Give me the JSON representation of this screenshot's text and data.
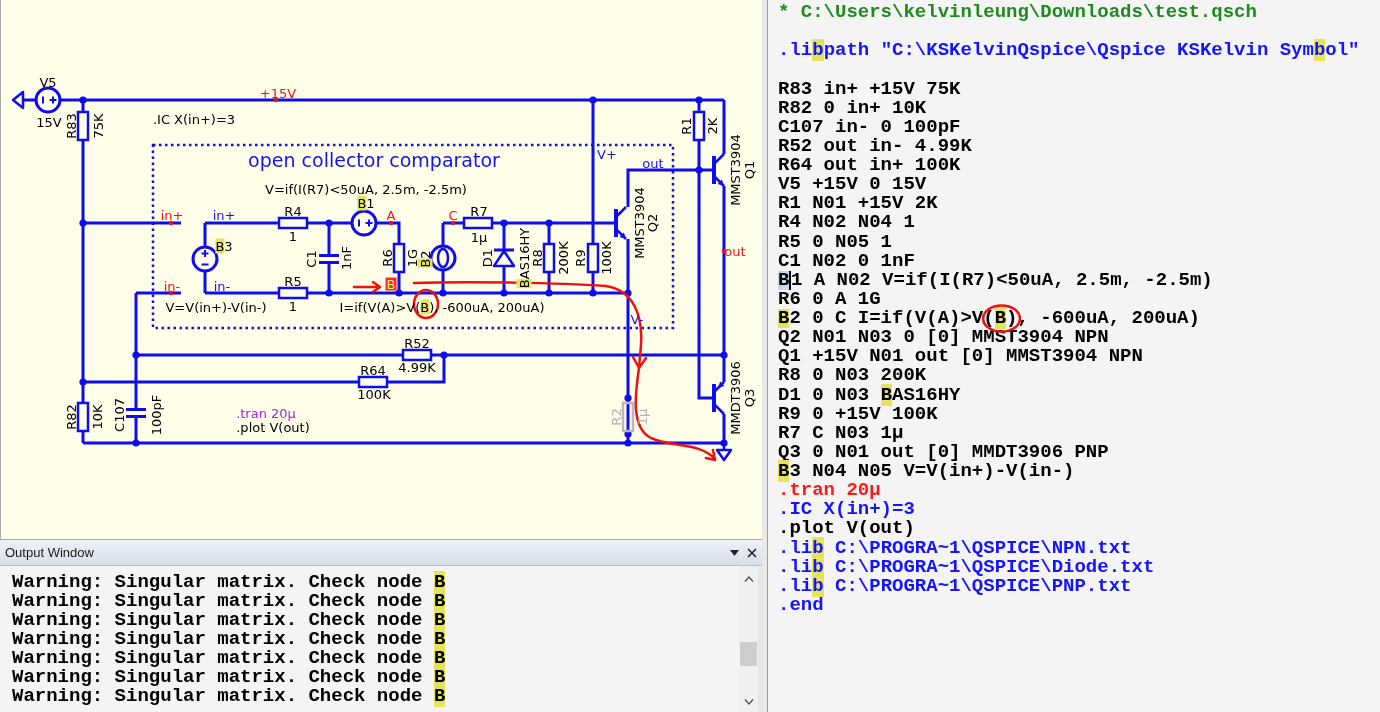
{
  "schematic": {
    "title": "open collector comparator",
    "directives": [
      {
        "text": ".IC X(in+)=3",
        "kind": "ic"
      },
      {
        "text": ".tran 20µ",
        "kind": "simulation"
      },
      {
        "text": ".plot V(out)",
        "kind": "plot"
      }
    ],
    "net_labels": [
      {
        "text": "+15V",
        "kind": "net"
      },
      {
        "text": "V+",
        "kind": "port"
      },
      {
        "text": "out",
        "kind": "port"
      },
      {
        "text": "in+",
        "kind": "net"
      },
      {
        "text": "in+",
        "kind": "port"
      },
      {
        "text": "A",
        "kind": "net"
      },
      {
        "text": "C",
        "kind": "net"
      },
      {
        "text": "out",
        "kind": "net"
      },
      {
        "text": "in-",
        "kind": "net"
      },
      {
        "text": "in-",
        "kind": "port"
      },
      {
        "text": "B",
        "kind": "flagged"
      },
      {
        "text": "V-",
        "kind": "port"
      }
    ],
    "expressions": [
      "V=if(I(R7)<50uA, 2.5m, -2.5m)",
      "V=V(in+)-V(in-)",
      [
        {
          "text": "I=if(V(A)>V(",
          "highlighted": false
        },
        {
          "text": "B",
          "highlighted": true
        },
        {
          "text": "), -600uA, 200uA)",
          "highlighted": false
        }
      ]
    ],
    "components": [
      {
        "kind": "voltage_source",
        "ref": "V5",
        "value": "15V",
        "disabled": false
      },
      {
        "kind": "resistor",
        "ref": "R83",
        "value": "75K",
        "disabled": false
      },
      {
        "kind": "resistor",
        "ref": "R1",
        "value": "2K",
        "disabled": false
      },
      {
        "kind": "npn",
        "ref": "Q1",
        "value": "MMST3904",
        "disabled": false
      },
      {
        "kind": "behavioral_voltage",
        "ref": [
          {
            "text": "B",
            "highlighted": true
          },
          {
            "text": "1",
            "highlighted": false
          }
        ],
        "disabled": false
      },
      {
        "kind": "resistor",
        "ref": "R4",
        "value": "1",
        "disabled": false
      },
      {
        "kind": "resistor",
        "ref": "R7",
        "value": "1µ",
        "disabled": false
      },
      {
        "kind": "npn",
        "ref": "Q2",
        "value": "MMST3904",
        "disabled": false
      },
      {
        "kind": "behavioral_voltage",
        "ref": [
          {
            "text": "B",
            "highlighted": true
          },
          {
            "text": "3",
            "highlighted": false
          }
        ],
        "disabled": false
      },
      {
        "kind": "capacitor",
        "ref": "C1",
        "value": "1nF",
        "disabled": false
      },
      {
        "kind": "resistor",
        "ref": "R6",
        "value": "1G",
        "disabled": false
      },
      {
        "kind": "behavioral_current",
        "ref": [
          {
            "text": "B",
            "highlighted": true
          },
          {
            "text": "2",
            "highlighted": false
          }
        ],
        "disabled": false
      },
      {
        "kind": "diode",
        "ref": "D1",
        "value": [
          {
            "text": "B",
            "highlighted": true
          },
          {
            "text": "AS16HY",
            "highlighted": false
          }
        ],
        "disabled": false
      },
      {
        "kind": "resistor",
        "ref": "R8",
        "value": "200K",
        "disabled": false
      },
      {
        "kind": "resistor",
        "ref": "R9",
        "value": "100K",
        "disabled": false
      },
      {
        "kind": "resistor",
        "ref": "R5",
        "value": "1",
        "disabled": false
      },
      {
        "kind": "resistor",
        "ref": "R52",
        "value": "4.99K",
        "disabled": false
      },
      {
        "kind": "resistor",
        "ref": "R64",
        "value": "100K",
        "disabled": false
      },
      {
        "kind": "resistor",
        "ref": "R82",
        "value": "10K",
        "disabled": false
      },
      {
        "kind": "capacitor",
        "ref": "C107",
        "value": "100pF",
        "disabled": false
      },
      {
        "kind": "resistor",
        "ref": "R2",
        "value": "1µ",
        "disabled": true
      },
      {
        "kind": "pnp",
        "ref": "Q3",
        "value": "MMDT3906",
        "disabled": false
      }
    ]
  },
  "output_window": {
    "title": "Output Window",
    "lines": [
      {
        "parts": [
          {
            "text": "Warning: Singular matrix. Check node ",
            "highlighted": false
          },
          {
            "text": "B",
            "highlighted": true
          }
        ]
      },
      {
        "parts": [
          {
            "text": "Warning: Singular matrix. Check node ",
            "highlighted": false
          },
          {
            "text": "B",
            "highlighted": true
          }
        ]
      },
      {
        "parts": [
          {
            "text": "Warning: Singular matrix. Check node ",
            "highlighted": false
          },
          {
            "text": "B",
            "highlighted": true
          }
        ]
      },
      {
        "parts": [
          {
            "text": "Warning: Singular matrix. Check node ",
            "highlighted": false
          },
          {
            "text": "B",
            "highlighted": true
          }
        ]
      },
      {
        "parts": [
          {
            "text": "Warning: Singular matrix. Check node ",
            "highlighted": false
          },
          {
            "text": "B",
            "highlighted": true
          }
        ]
      },
      {
        "parts": [
          {
            "text": "Warning: Singular matrix. Check node ",
            "highlighted": false
          },
          {
            "text": "B",
            "highlighted": true
          }
        ]
      },
      {
        "parts": [
          {
            "text": "Warning: Singular matrix. Check node ",
            "highlighted": false
          },
          {
            "text": "B",
            "highlighted": true
          }
        ]
      }
    ]
  },
  "netlist": {
    "blocks": [
      {
        "lines": [
          {
            "kind": "comment",
            "text": "* C:\\Users\\kelvinleung\\Downloads\\test.qsch"
          }
        ]
      },
      {
        "lines": [
          {
            "kind": "directive",
            "parts": [
              {
                "kind": "text",
                "text": ".li",
                "highlighted": false
              },
              {
                "kind": "text",
                "text": "b",
                "highlighted": true
              },
              {
                "kind": "text",
                "text": "path \"C:\\KSKelvinQspice\\Qspice KSKelvin Sym",
                "highlighted": false
              },
              {
                "kind": "text",
                "text": "b",
                "highlighted": true
              },
              {
                "kind": "text",
                "text": "ol\"",
                "highlighted": false
              }
            ]
          }
        ]
      },
      {
        "lines": [
          {
            "kind": "element",
            "text": "R83 in+ +15V 75K"
          },
          {
            "kind": "element",
            "text": "R82 0 in+ 10K"
          },
          {
            "kind": "element",
            "text": "C107 in- 0 100pF"
          },
          {
            "kind": "element",
            "text": "R52 out in- 4.99K"
          },
          {
            "kind": "element",
            "text": "R64 out in+ 100K"
          },
          {
            "kind": "element",
            "text": "V5 +15V 0 15V"
          },
          {
            "kind": "element",
            "text": "R1 N01 +15V 2K"
          },
          {
            "kind": "element",
            "text": "R4 N02 N04 1"
          },
          {
            "kind": "element",
            "text": "R5 0 N05 1"
          },
          {
            "kind": "element",
            "text": "C1 N02 0 1nF"
          },
          {
            "kind": "element",
            "parts": [
              {
                "kind": "selection",
                "text": "B"
              },
              {
                "kind": "caret"
              },
              {
                "kind": "text",
                "text": "1 A N02 V=if(I(R7)<50uA, 2.5m, -2.5m)",
                "highlighted": false
              }
            ]
          },
          {
            "kind": "element",
            "text": "R6 0 A 1G"
          },
          {
            "kind": "element",
            "parts": [
              {
                "kind": "text",
                "text": "B",
                "highlighted": true
              },
              {
                "kind": "text",
                "text": "2 0 C I=if(V(A)>V",
                "highlighted": false
              },
              {
                "kind": "circled",
                "parts": [
                  {
                    "text": "(",
                    "highlighted": false
                  },
                  {
                    "text": "B",
                    "highlighted": true
                  },
                  {
                    "text": ")",
                    "highlighted": false
                  }
                ]
              },
              {
                "kind": "text",
                "text": ", -600uA, 200uA)",
                "highlighted": false
              }
            ]
          },
          {
            "kind": "element",
            "text": "Q2 N01 N03 0 [0] MMST3904 NPN"
          },
          {
            "kind": "element",
            "text": "Q1 +15V N01 out [0] MMST3904 NPN"
          },
          {
            "kind": "element",
            "text": "R8 0 N03 200K"
          },
          {
            "kind": "element",
            "parts": [
              {
                "kind": "text",
                "text": "D1 0 N03 ",
                "highlighted": false
              },
              {
                "kind": "text",
                "text": "B",
                "highlighted": true
              },
              {
                "kind": "text",
                "text": "AS16HY",
                "highlighted": false
              }
            ]
          },
          {
            "kind": "element",
            "text": "R9 0 +15V 100K"
          },
          {
            "kind": "element",
            "text": "R7 C N03 1µ"
          },
          {
            "kind": "element",
            "text": "Q3 0 N01 out [0] MMDT3906 PNP"
          },
          {
            "kind": "element",
            "parts": [
              {
                "kind": "text",
                "text": "B",
                "highlighted": true
              },
              {
                "kind": "text",
                "text": "3 N04 N05 V=V(in+)-V(in-)",
                "highlighted": false
              }
            ]
          },
          {
            "kind": "simulation",
            "text": ".tran 20µ"
          },
          {
            "kind": "directive",
            "text": ".IC X(in+)=3"
          },
          {
            "kind": "plot",
            "text": ".plot V(out)"
          },
          {
            "kind": "directive",
            "parts": [
              {
                "kind": "text",
                "text": ".li",
                "highlighted": false
              },
              {
                "kind": "text",
                "text": "b",
                "highlighted": true
              },
              {
                "kind": "text",
                "text": " C:\\PROGRA~1\\QSPICE\\NPN.txt",
                "highlighted": false
              }
            ]
          },
          {
            "kind": "directive",
            "parts": [
              {
                "kind": "text",
                "text": ".li",
                "highlighted": false
              },
              {
                "kind": "text",
                "text": "b",
                "highlighted": true
              },
              {
                "kind": "text",
                "text": " C:\\PROGRA~1\\QSPICE\\Diode.txt",
                "highlighted": false
              }
            ]
          },
          {
            "kind": "directive",
            "parts": [
              {
                "kind": "text",
                "text": ".li",
                "highlighted": false
              },
              {
                "kind": "text",
                "text": "b",
                "highlighted": true
              },
              {
                "kind": "text",
                "text": " C:\\PROGRA~1\\QSPICE\\PNP.txt",
                "highlighted": false
              }
            ]
          },
          {
            "kind": "directive",
            "text": ".end"
          }
        ]
      }
    ]
  }
}
